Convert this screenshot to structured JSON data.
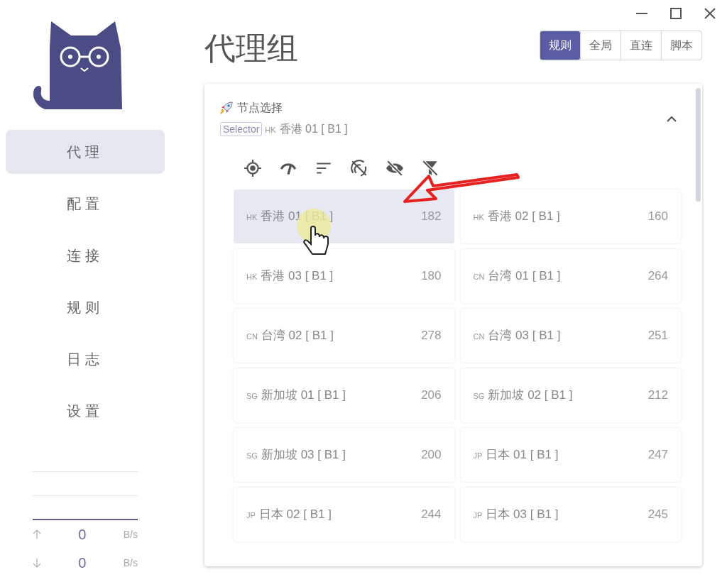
{
  "sidebar": {
    "items": [
      {
        "label": "代理",
        "selected": true
      },
      {
        "label": "配置",
        "selected": false
      },
      {
        "label": "连接",
        "selected": false
      },
      {
        "label": "规则",
        "selected": false
      },
      {
        "label": "日志",
        "selected": false
      },
      {
        "label": "设置",
        "selected": false
      }
    ],
    "traffic": [
      {
        "kind": "up",
        "value": "0",
        "unit": "B/s"
      },
      {
        "kind": "down",
        "value": "0",
        "unit": "B/s"
      }
    ]
  },
  "title": "代理组",
  "modes": [
    {
      "label": "规则",
      "selected": true
    },
    {
      "label": "全局",
      "selected": false
    },
    {
      "label": "直连",
      "selected": false
    },
    {
      "label": "脚本",
      "selected": false
    }
  ],
  "group": {
    "name": "节点选择",
    "type_badge": "Selector",
    "current_region": "HK",
    "current": "香港 01 [ B1 ]",
    "expanded": true,
    "nodes": [
      {
        "region": "HK",
        "name": "香港 01 [ B1 ]",
        "delay": "182",
        "selected": true
      },
      {
        "region": "HK",
        "name": "香港 02 [ B1 ]",
        "delay": "160",
        "selected": false
      },
      {
        "region": "HK",
        "name": "香港 03 [ B1 ]",
        "delay": "180",
        "selected": false
      },
      {
        "region": "CN",
        "name": "台湾 01 [ B1 ]",
        "delay": "264",
        "selected": false
      },
      {
        "region": "CN",
        "name": "台湾 02 [ B1 ]",
        "delay": "278",
        "selected": false
      },
      {
        "region": "CN",
        "name": "台湾 03 [ B1 ]",
        "delay": "251",
        "selected": false
      },
      {
        "region": "SG",
        "name": "新加坡 01 [ B1 ]",
        "delay": "206",
        "selected": false
      },
      {
        "region": "SG",
        "name": "新加坡 02 [ B1 ]",
        "delay": "212",
        "selected": false
      },
      {
        "region": "SG",
        "name": "新加坡 03 [ B1 ]",
        "delay": "200",
        "selected": false
      },
      {
        "region": "JP",
        "name": "日本 01 [ B1 ]",
        "delay": "247",
        "selected": false
      },
      {
        "region": "JP",
        "name": "日本 02 [ B1 ]",
        "delay": "244",
        "selected": false
      },
      {
        "region": "JP",
        "name": "日本 03 [ B1 ]",
        "delay": "245",
        "selected": false
      }
    ]
  }
}
